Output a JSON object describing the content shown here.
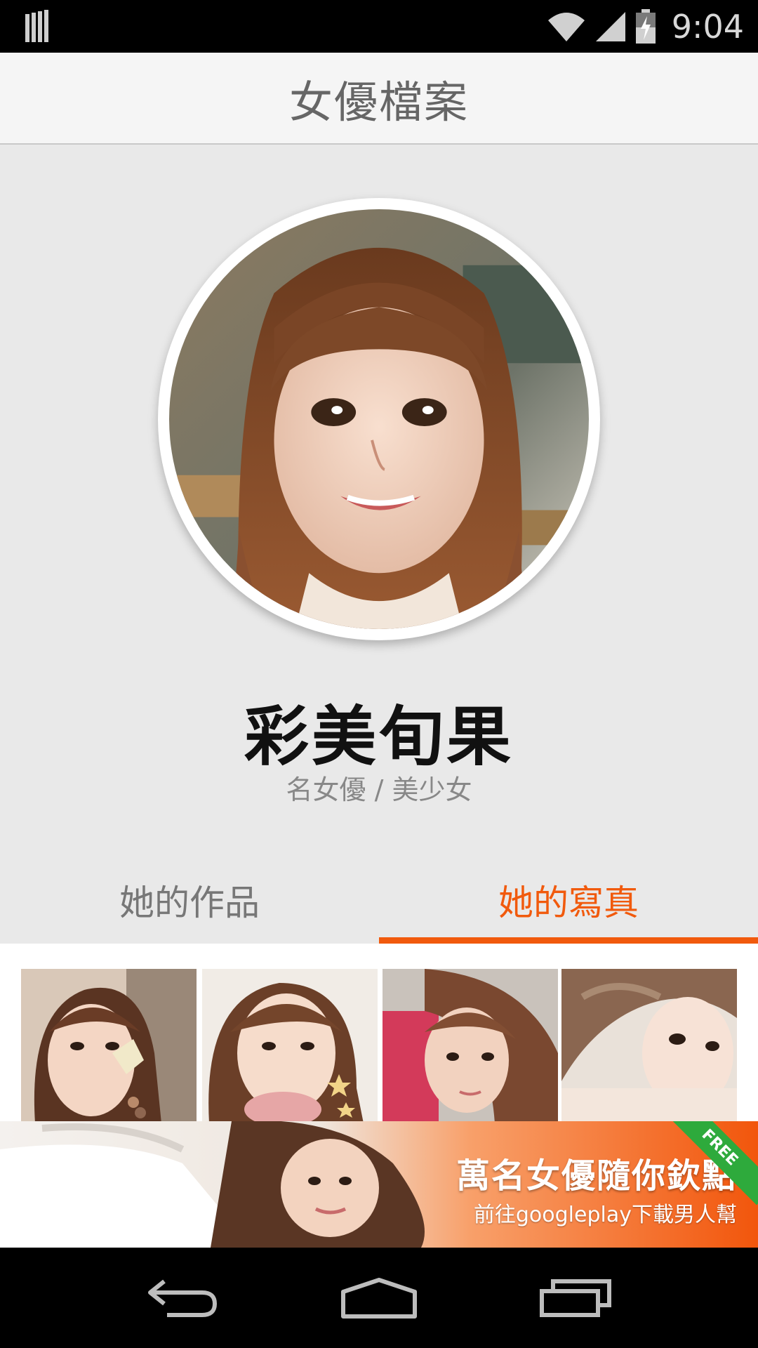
{
  "status_bar": {
    "time": "9:04",
    "icons": [
      "notification-icon",
      "wifi-icon",
      "signal-icon",
      "battery-charging-icon"
    ]
  },
  "header": {
    "title": "女優檔案"
  },
  "profile": {
    "name": "彩美旬果",
    "tags": "名女優 / 美少女"
  },
  "tabs": [
    {
      "label": "她的作品",
      "active": false
    },
    {
      "label": "她的寫真",
      "active": true
    }
  ],
  "accent_color": "#f15a0d",
  "photos": [
    {
      "name": "photo-1"
    },
    {
      "name": "photo-2"
    },
    {
      "name": "photo-3"
    },
    {
      "name": "photo-4"
    }
  ],
  "ad": {
    "headline": "萬名女優隨你欽點",
    "subline": "前往googleplay下載男人幫",
    "ribbon": "FREE"
  },
  "nav_bar": {
    "buttons": [
      "back-icon",
      "home-icon",
      "recents-icon"
    ]
  }
}
